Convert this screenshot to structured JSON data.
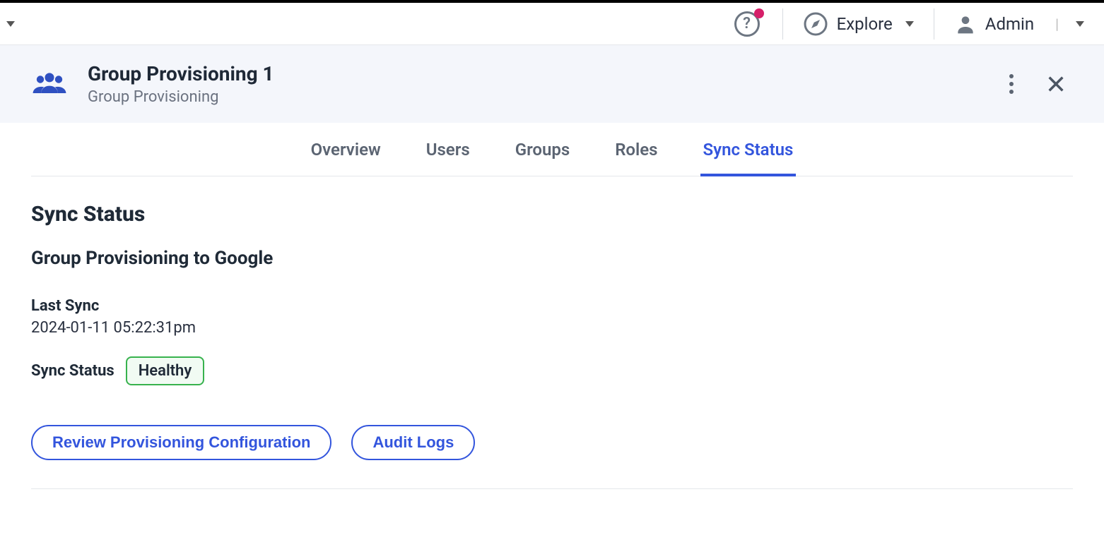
{
  "topnav": {
    "explore_label": "Explore",
    "user_label": "Admin"
  },
  "page_header": {
    "title": "Group Provisioning 1",
    "subtitle": "Group Provisioning"
  },
  "tabs": [
    {
      "label": "Overview",
      "active": false
    },
    {
      "label": "Users",
      "active": false
    },
    {
      "label": "Groups",
      "active": false
    },
    {
      "label": "Roles",
      "active": false
    },
    {
      "label": "Sync Status",
      "active": true
    }
  ],
  "sync": {
    "heading": "Sync Status",
    "subheading": "Group Provisioning to Google",
    "last_sync_label": "Last Sync",
    "last_sync_value": "2024-01-11 05:22:31pm",
    "status_label": "Sync Status",
    "status_value": "Healthy",
    "btn_review": "Review Provisioning Configuration",
    "btn_audit": "Audit Logs"
  }
}
